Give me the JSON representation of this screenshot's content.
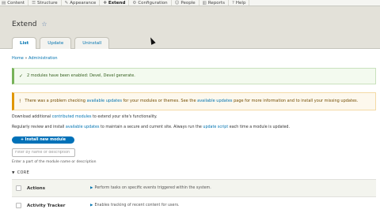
{
  "toolbar": {
    "items": [
      {
        "label": "Content",
        "icon": "document-icon"
      },
      {
        "label": "Structure",
        "icon": "structure-icon"
      },
      {
        "label": "Appearance",
        "icon": "brush-icon"
      },
      {
        "label": "Extend",
        "icon": "puzzle-icon"
      },
      {
        "label": "Configuration",
        "icon": "wrench-icon"
      },
      {
        "label": "People",
        "icon": "person-icon"
      },
      {
        "label": "Reports",
        "icon": "chart-icon"
      },
      {
        "label": "Help",
        "icon": "help-icon"
      }
    ]
  },
  "page": {
    "title": "Extend",
    "star": "☆"
  },
  "tabs": [
    {
      "label": "List"
    },
    {
      "label": "Update"
    },
    {
      "label": "Uninstall"
    }
  ],
  "breadcrumb": {
    "home": "Home",
    "sep": "»",
    "admin": "Administration"
  },
  "status_message": {
    "icon": "✓",
    "text": "2 modules have been enabled: Devel, Devel generate."
  },
  "warning_message": {
    "icon": "!",
    "part1": "There was a problem checking ",
    "link1": "available updates",
    "part2": " for your modules or themes. See the ",
    "link2": "available updates",
    "part3": " page for more information and to install your missing updates."
  },
  "download_line": {
    "part1": "Download additional ",
    "link": "contributed modules",
    "part2": " to extend your site's functionality."
  },
  "review_line": {
    "part1": "Regularly review and install ",
    "link1": "available updates",
    "part2": " to maintain a secure and current site. Always run the ",
    "link2": "update script",
    "part3": " each time a module is updated."
  },
  "install_button": {
    "label": "+ Install new module"
  },
  "filter": {
    "placeholder": "Filter by name or description",
    "description": "Enter a part of the module name or description"
  },
  "core_section": {
    "label": "CORE"
  },
  "modules": [
    {
      "name": "Actions",
      "description": "Perform tasks on specific events triggered within the system."
    },
    {
      "name": "Activity Tracker",
      "description": "Enables tracking of recent content for users."
    }
  ]
}
